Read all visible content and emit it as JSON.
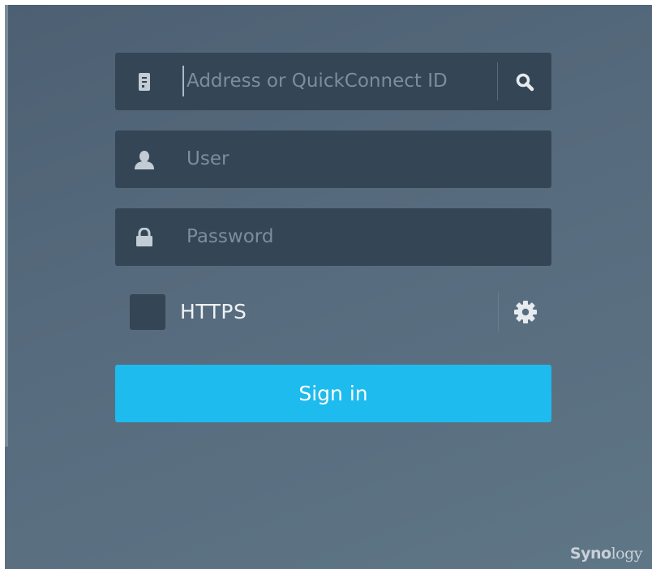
{
  "login": {
    "address_placeholder": "Address or QuickConnect ID",
    "user_placeholder": "User",
    "password_placeholder": "Password",
    "https_label": "HTTPS",
    "https_checked": false,
    "signin_label": "Sign in"
  },
  "icons": {
    "address": "server-icon",
    "search": "search-icon",
    "user": "user-icon",
    "password": "lock-icon",
    "settings": "gear-icon"
  },
  "colors": {
    "panel_background": "#566b7d",
    "field_background": "#344556",
    "signin_button": "#1ebbee"
  },
  "brand": {
    "logo_text": "Synology"
  }
}
